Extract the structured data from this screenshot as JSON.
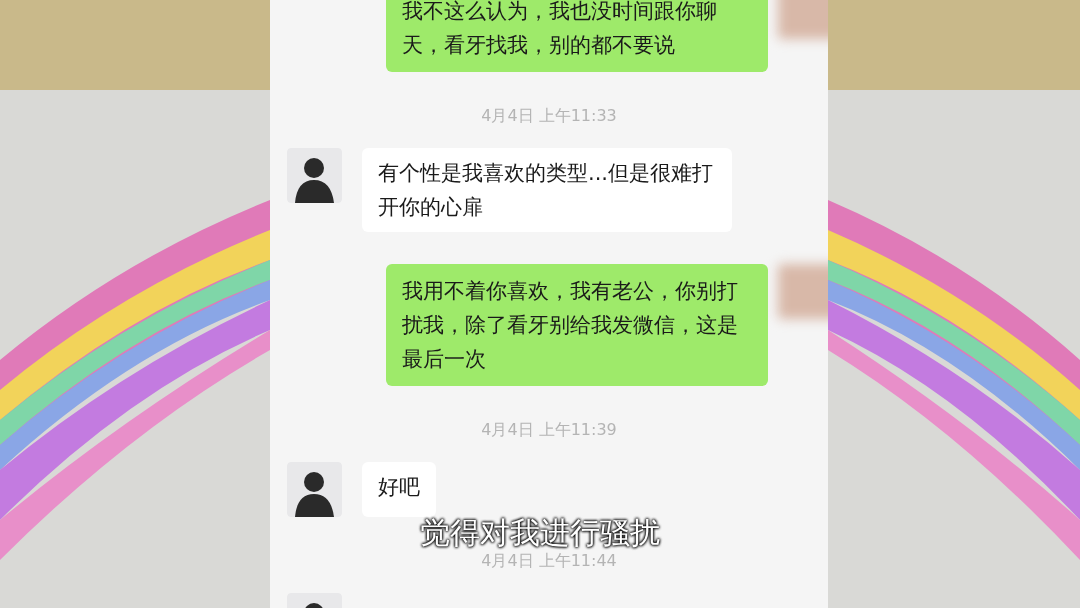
{
  "chat": {
    "messages": [
      {
        "kind": "outgoing",
        "text": "我不这么认为，我也没时间跟你聊天，看牙找我，别的都不要说"
      },
      {
        "kind": "time",
        "text": "4月4日 上午11:33"
      },
      {
        "kind": "incoming",
        "text": "有个性是我喜欢的类型...但是很难打开你的心扉"
      },
      {
        "kind": "outgoing",
        "text": "我用不着你喜欢，我有老公，你别打扰我，除了看牙别给我发微信，这是最后一次"
      },
      {
        "kind": "time",
        "text": "4月4日 上午11:39"
      },
      {
        "kind": "incoming",
        "text": "好吧"
      },
      {
        "kind": "time",
        "text": "4月4日 上午11:44"
      },
      {
        "kind": "incoming"
      }
    ]
  },
  "subtitle": "觉得对我进行骚扰"
}
